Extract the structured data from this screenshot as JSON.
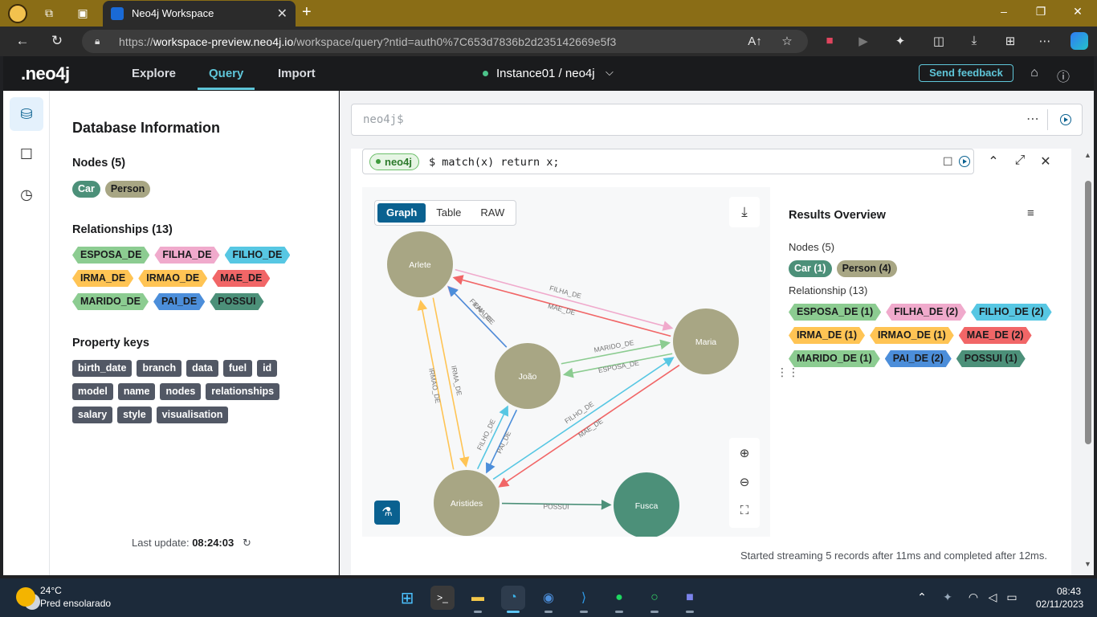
{
  "browser": {
    "tab_title": "Neo4j Workspace",
    "url_prefix": "https://",
    "url_host": "workspace-preview.neo4j.io",
    "url_path": "/workspace/query?ntid=auth0%7C653d7836b2d235142669e5f3"
  },
  "app": {
    "logo": ".neo4j",
    "nav": [
      "Explore",
      "Query",
      "Import"
    ],
    "active_nav": "Query",
    "instance": "Instance01 / neo4j",
    "feedback_label": "Send feedback"
  },
  "db_info": {
    "title": "Database Information",
    "nodes_title": "Nodes (5)",
    "nodes": [
      {
        "label": "Car",
        "color": "#4c9079"
      },
      {
        "label": "Person",
        "color": "#a8a684"
      }
    ],
    "relationships_title": "Relationships (13)",
    "relationships": [
      [
        {
          "label": "ESPOSA_DE",
          "color": "#8ccc91"
        },
        {
          "label": "FILHA_DE",
          "color": "#f0aacc"
        },
        {
          "label": "FILHO_DE",
          "color": "#57c7e3"
        }
      ],
      [
        {
          "label": "IRMA_DE",
          "color": "#ffc454"
        },
        {
          "label": "IRMAO_DE",
          "color": "#ffc454"
        },
        {
          "label": "MAE_DE",
          "color": "#f16667"
        }
      ],
      [
        {
          "label": "MARIDO_DE",
          "color": "#8ccc91"
        },
        {
          "label": "PAI_DE",
          "color": "#4c8eda"
        },
        {
          "label": "POSSUI",
          "color": "#4c9079"
        }
      ]
    ],
    "property_title": "Property keys",
    "property_keys": [
      [
        "birth_date",
        "branch",
        "data",
        "fuel",
        "id"
      ],
      [
        "model",
        "name",
        "nodes",
        "relationships"
      ],
      [
        "salary",
        "style",
        "visualisation"
      ]
    ],
    "last_update_label": "Last update:",
    "last_update_time": "08:24:03"
  },
  "editor": {
    "placeholder": "neo4j$",
    "more": "⋯"
  },
  "result": {
    "db_badge": "neo4j",
    "query": "$ match(x) return x;",
    "view_tabs": [
      "Graph",
      "Table",
      "RAW"
    ],
    "active_view": "Graph",
    "graph": {
      "nodes": [
        {
          "label": "Arlete",
          "color": "#a8a684"
        },
        {
          "label": "João",
          "color": "#a8a684"
        },
        {
          "label": "Maria",
          "color": "#a8a684"
        },
        {
          "label": "Aristides",
          "color": "#a8a684"
        },
        {
          "label": "Fusca",
          "color": "#4c9079"
        }
      ],
      "edge_labels": [
        "FILHA_DE",
        "MAE_DE",
        "FILHA_DE",
        "PAI_DE",
        "MARIDO_DE",
        "ESPOSA_DE",
        "IRMA_DE",
        "IRMAO_DE",
        "FILHO_DE",
        "PAI_DE",
        "FILHO_DE",
        "MAE_DE",
        "POSSUI"
      ]
    },
    "overview": {
      "title": "Results Overview",
      "nodes_title": "Nodes (5)",
      "nodes": [
        {
          "label": "Car (1)",
          "color": "#4c9079"
        },
        {
          "label": "Person (4)",
          "color": "#a8a684"
        }
      ],
      "rel_title": "Relationship (13)",
      "relationships": [
        [
          {
            "label": "ESPOSA_DE (1)",
            "color": "#8ccc91"
          },
          {
            "label": "FILHA_DE (2)",
            "color": "#f0aacc"
          },
          {
            "label": "FILHO_DE (2)",
            "color": "#57c7e3"
          }
        ],
        [
          {
            "label": "IRMA_DE (1)",
            "color": "#ffc454"
          },
          {
            "label": "IRMAO_DE (1)",
            "color": "#ffc454"
          },
          {
            "label": "MAE_DE (2)",
            "color": "#f16667"
          }
        ],
        [
          {
            "label": "MARIDO_DE (1)",
            "color": "#8ccc91"
          },
          {
            "label": "PAI_DE (2)",
            "color": "#4c8eda"
          },
          {
            "label": "POSSUI (1)",
            "color": "#4c9079"
          }
        ]
      ]
    },
    "footer": "Started streaming 5 records after 11ms and completed after 12ms."
  },
  "taskbar": {
    "temp": "24°C",
    "weather": "Pred ensolarado",
    "time": "08:43",
    "date": "02/11/2023"
  }
}
